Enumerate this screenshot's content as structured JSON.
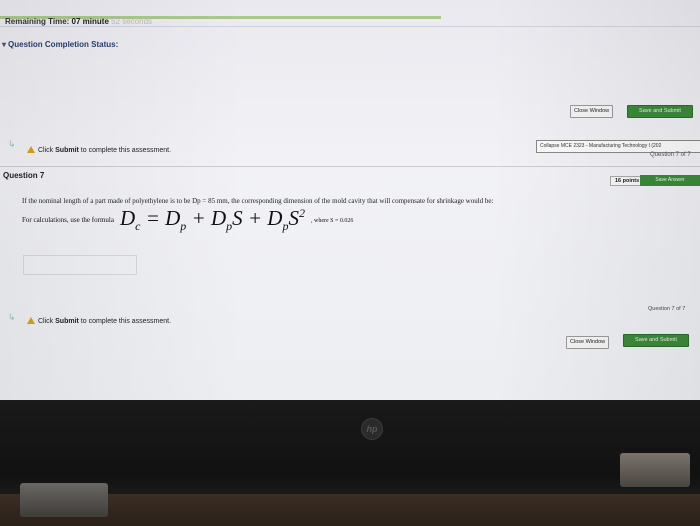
{
  "timer": {
    "label": "Remaining Time:",
    "value": "07 minute",
    "seconds": "52 seconds",
    "progress": 0.63
  },
  "status": {
    "label": "Question Completion Status:"
  },
  "buttons": {
    "close_window": "Close Window",
    "save_submit": "Save and Submit",
    "save_answer": "Save Answer"
  },
  "submit_note": {
    "prefix": "Click ",
    "bold": "Submit",
    "suffix": " to complete this assessment."
  },
  "course": {
    "label": "Collapse MCE 2323 - Manufacturing Technology I (202"
  },
  "question": {
    "counter_top": "Question 7 of 7",
    "title": "Question 7",
    "points": "16 points",
    "text": "If the nominal length of a part made of polyethylene is to be Dp = 85 mm, the corresponding dimension of the mold cavity that will compensate for shrinkage would be:",
    "formula_lead": "For calculations, use the formula",
    "formula_tail": ", where S = 0.026",
    "counter_bottom": "Question 7 of 7"
  },
  "device": {
    "logo": "hp"
  }
}
